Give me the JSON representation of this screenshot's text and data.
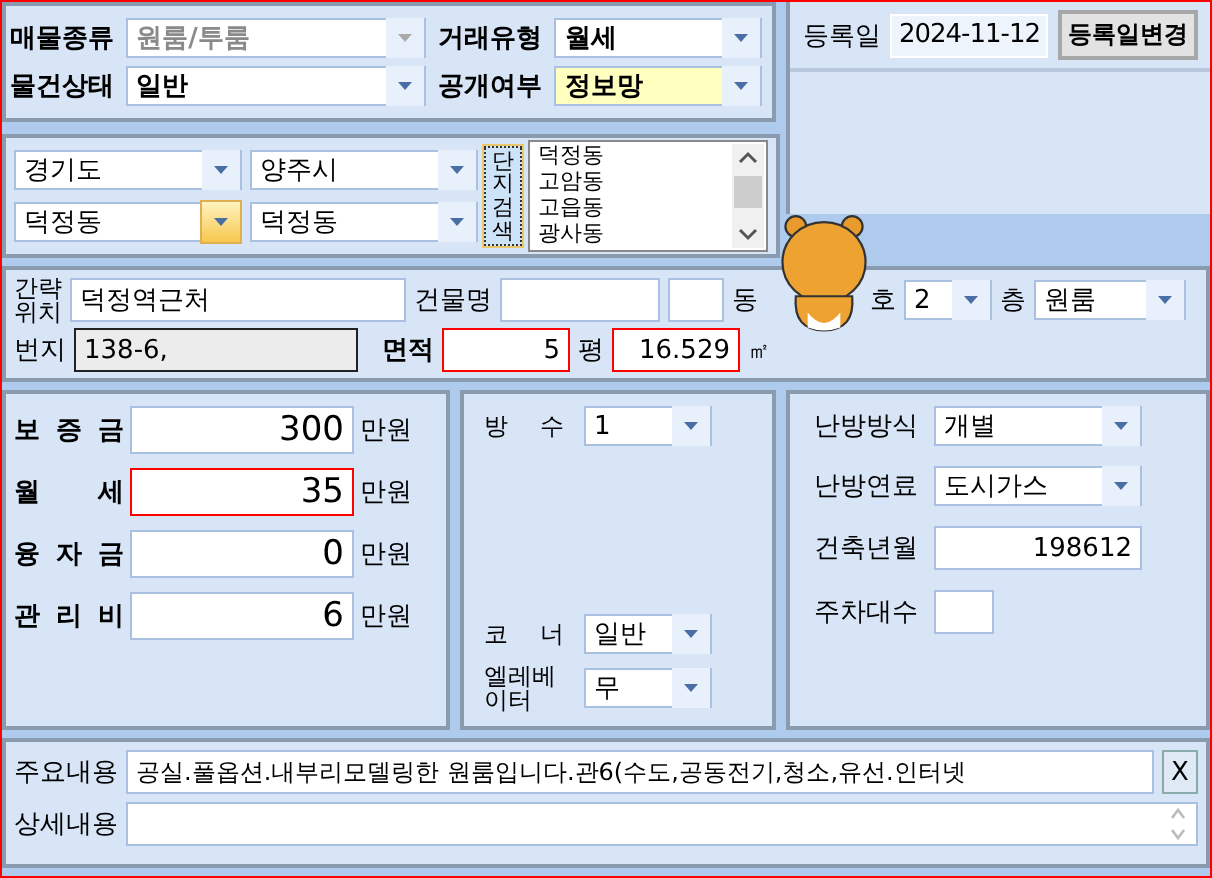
{
  "listing": [
    {
      "label": "매물종류",
      "value": "원룸/투룸",
      "disabled": true,
      "highlight": false
    },
    {
      "label": "거래유형",
      "value": "월세",
      "disabled": false,
      "highlight": false
    },
    {
      "label": "물건상태",
      "value": "일반",
      "disabled": false,
      "highlight": false
    },
    {
      "label": "공개여부",
      "value": "정보망",
      "disabled": false,
      "highlight": true
    }
  ],
  "registration": {
    "label": "등록일",
    "date": "2024-11-12",
    "button": "등록일변경"
  },
  "region": {
    "selects": [
      {
        "value": "경기도",
        "active": false
      },
      {
        "value": "양주시",
        "active": false
      },
      {
        "value": "덕정동",
        "active": true
      },
      {
        "value": "덕정동",
        "active": false
      }
    ],
    "search_button": "단지검색",
    "dong_list": [
      "덕정동",
      "고암동",
      "고읍동",
      "광사동"
    ]
  },
  "address": {
    "location_label": "간략위치",
    "location": "덕정역근처",
    "building_label": "건물명",
    "dong_label": "동",
    "ho_label": "호",
    "ho": "2",
    "floor_label": "층",
    "floor": "원룸",
    "lot_label": "번지",
    "lot": "138-6,",
    "area_label": "면적",
    "area_pyeong": "5",
    "pyeong_unit": "평",
    "area_m2": "16.529",
    "m2_unit": "㎡"
  },
  "money": [
    {
      "label": "보 증 금",
      "value": "300",
      "unit": "만원",
      "flagged": false
    },
    {
      "label": "월 세",
      "value": "35",
      "unit": "만원",
      "flagged": true
    },
    {
      "label": "융 자 금",
      "value": "0",
      "unit": "만원",
      "flagged": false
    },
    {
      "label": "관 리 비",
      "value": "6",
      "unit": "만원",
      "flagged": false
    }
  ],
  "room": [
    {
      "label": "방 수",
      "value": "1"
    },
    {
      "label": "코 너",
      "value": "일반"
    },
    {
      "label": "엘레베이터",
      "value": "무"
    }
  ],
  "facility": [
    {
      "label": "난방방식",
      "value": "개별",
      "kind": "combo"
    },
    {
      "label": "난방연료",
      "value": "도시가스",
      "kind": "combo"
    },
    {
      "label": "건축년월",
      "value": "198612",
      "kind": "number"
    },
    {
      "label": "주차대수",
      "kind": "short"
    }
  ],
  "notes": {
    "summary_label": "주요내용",
    "summary": "공실.풀옵션.내부리모델링한 원룸입니다.관6(수도,공동전기,청소,유선.인터넷",
    "clear_button": "X",
    "detail_label": "상세내용"
  }
}
